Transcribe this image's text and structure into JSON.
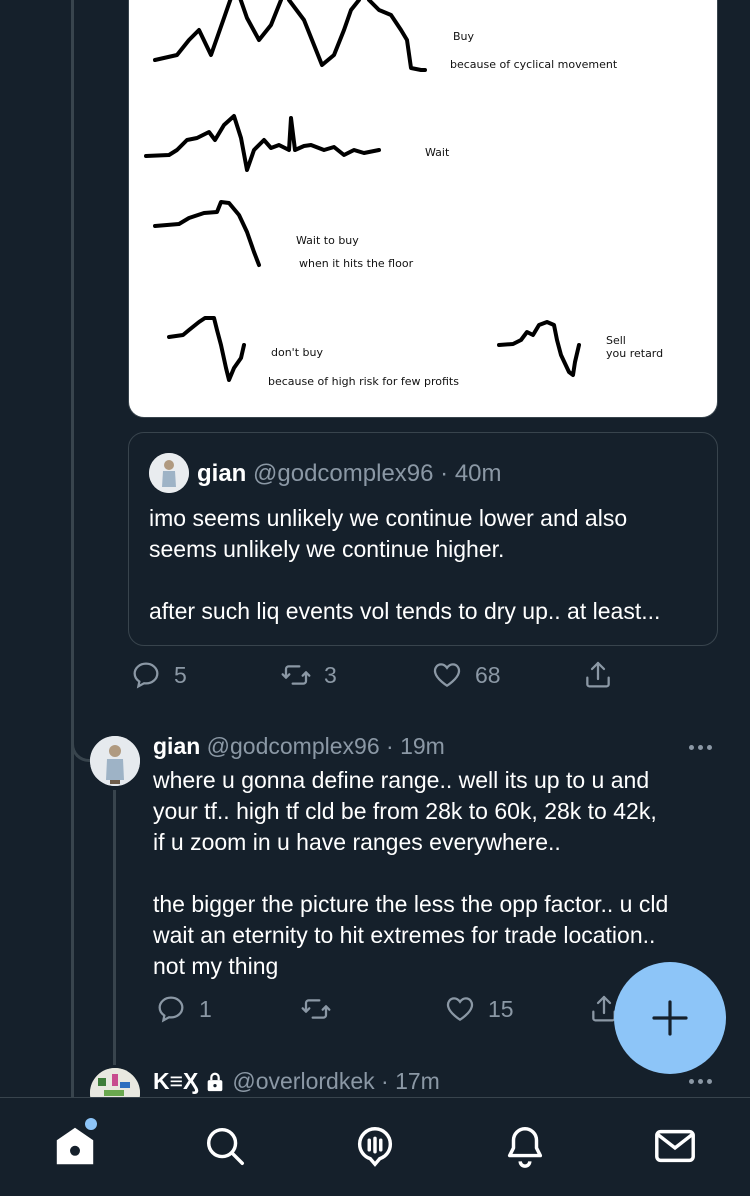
{
  "image": {
    "labels": {
      "buy": "Buy",
      "buy_reason": "because of cyclical movement",
      "wait": "Wait",
      "wait_to_buy": "Wait to buy",
      "wait_to_buy_reason": "when it hits the floor",
      "dont_buy": "don't buy",
      "dont_buy_reason": "because of high risk for few profits",
      "sell": "Sell",
      "sell_reason": "you retard"
    }
  },
  "quote": {
    "name": "gian",
    "handle": "@godcomplex96",
    "separator": " · ",
    "time": "40m",
    "lines": [
      "imo seems unlikely we continue lower and also",
      "seems unlikely we continue higher.",
      "",
      "after such liq events vol tends to dry up.. at least..."
    ]
  },
  "main_actions": {
    "replies": "5",
    "retweets": "3",
    "likes": "68"
  },
  "reply": {
    "name": "gian",
    "handle": "@godcomplex96",
    "separator": " · ",
    "time": "19m",
    "lines": [
      "where u gonna define range.. well its up to u and",
      "your tf.. high tf cld be from 28k to 60k, 28k to 42k,",
      "if u zoom in u have ranges everywhere..",
      "",
      "the bigger the picture the less the opp factor.. u cld",
      "wait an eternity to hit extremes for trade location..",
      "not my thing"
    ],
    "actions": {
      "replies": "1",
      "retweets": "",
      "likes": "15"
    }
  },
  "next_tweet": {
    "name": "K≡Ӽ",
    "handle": "@overlordkek",
    "separator": " · ",
    "time": "17m"
  },
  "icons": {
    "reply": "reply-icon",
    "retweet": "retweet-icon",
    "like": "heart-icon",
    "share": "share-icon",
    "more": "more-icon",
    "compose": "plus-icon",
    "lock": "lock-icon",
    "nav": [
      "home-icon",
      "search-icon",
      "spaces-icon",
      "bell-icon",
      "mail-icon"
    ]
  },
  "colors": {
    "background": "#15202b",
    "accent": "#8dc5f8",
    "muted": "#8b98a5",
    "border": "#38444d"
  }
}
